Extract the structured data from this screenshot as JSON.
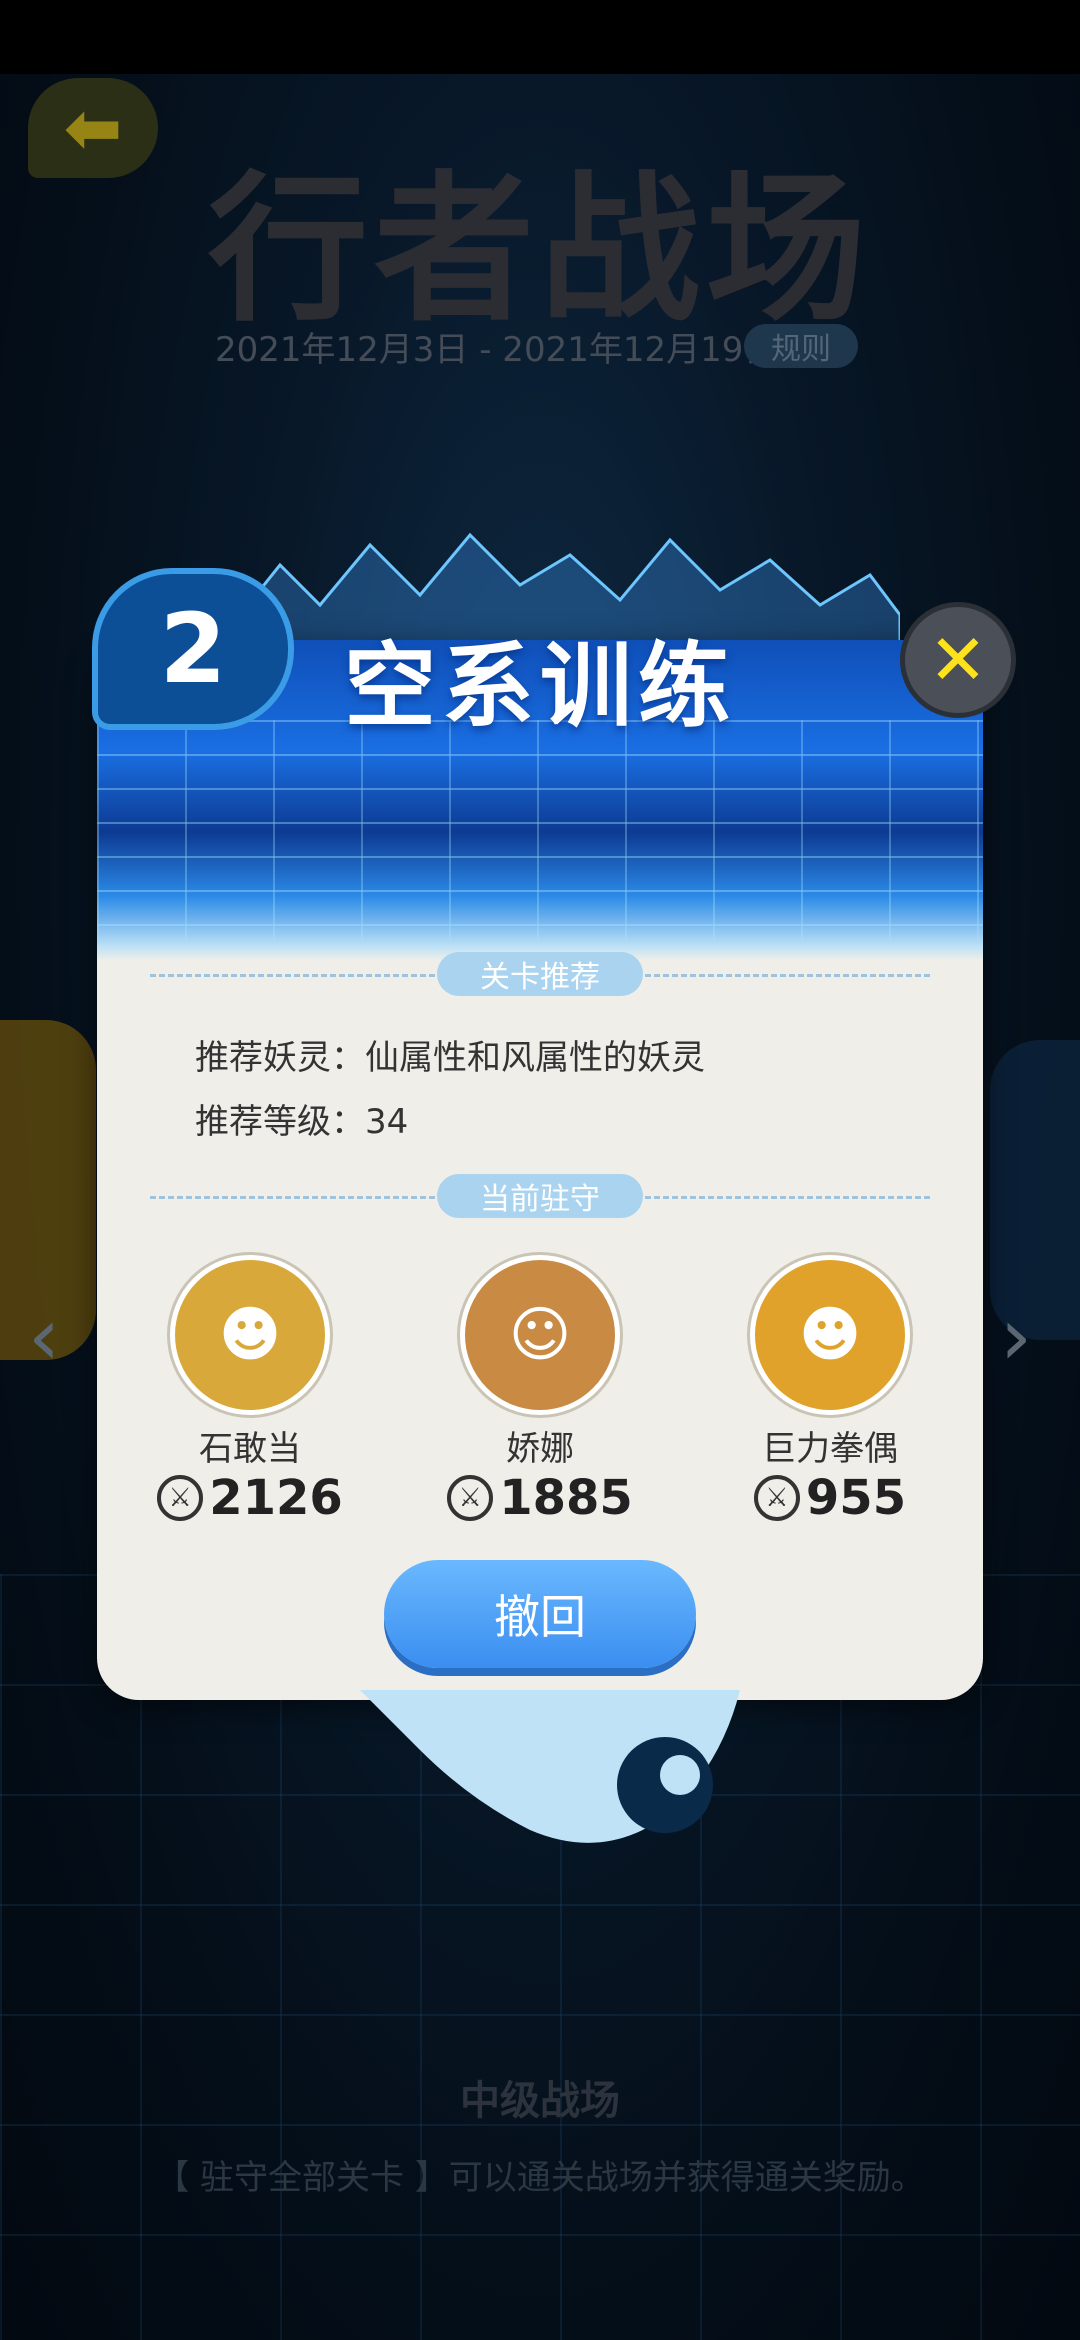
{
  "background": {
    "page_title": "行者战场",
    "date_range": "2021年12月3日 - 2021年12月19日",
    "rules_label": "规则",
    "back_icon": "arrow-left-icon",
    "tier_label": "中级战场",
    "footer_hint": "【 驻守全部关卡 】可以通关战场并获得通关奖励。"
  },
  "dialog": {
    "level_number": "2",
    "title": "空系训练",
    "close_icon": "close-icon",
    "section_recommend": "关卡推荐",
    "recommend_spirit": "推荐妖灵：仙属性和风属性的妖灵",
    "recommend_level": "推荐等级：34",
    "section_guard": "当前驻守",
    "guards": [
      {
        "name": "石敢当",
        "power": "2126",
        "color": "#d9a83a"
      },
      {
        "name": "娇娜",
        "power": "1885",
        "color": "#c98a44"
      },
      {
        "name": "巨力拳偶",
        "power": "955",
        "color": "#e0a22a"
      }
    ],
    "withdraw_label": "撤回"
  },
  "colors": {
    "dialog_bg": "#efeee8",
    "header_blue": "#1a6fe3",
    "button_blue": "#3a8ef0",
    "close_yellow": "#ffe21a"
  }
}
